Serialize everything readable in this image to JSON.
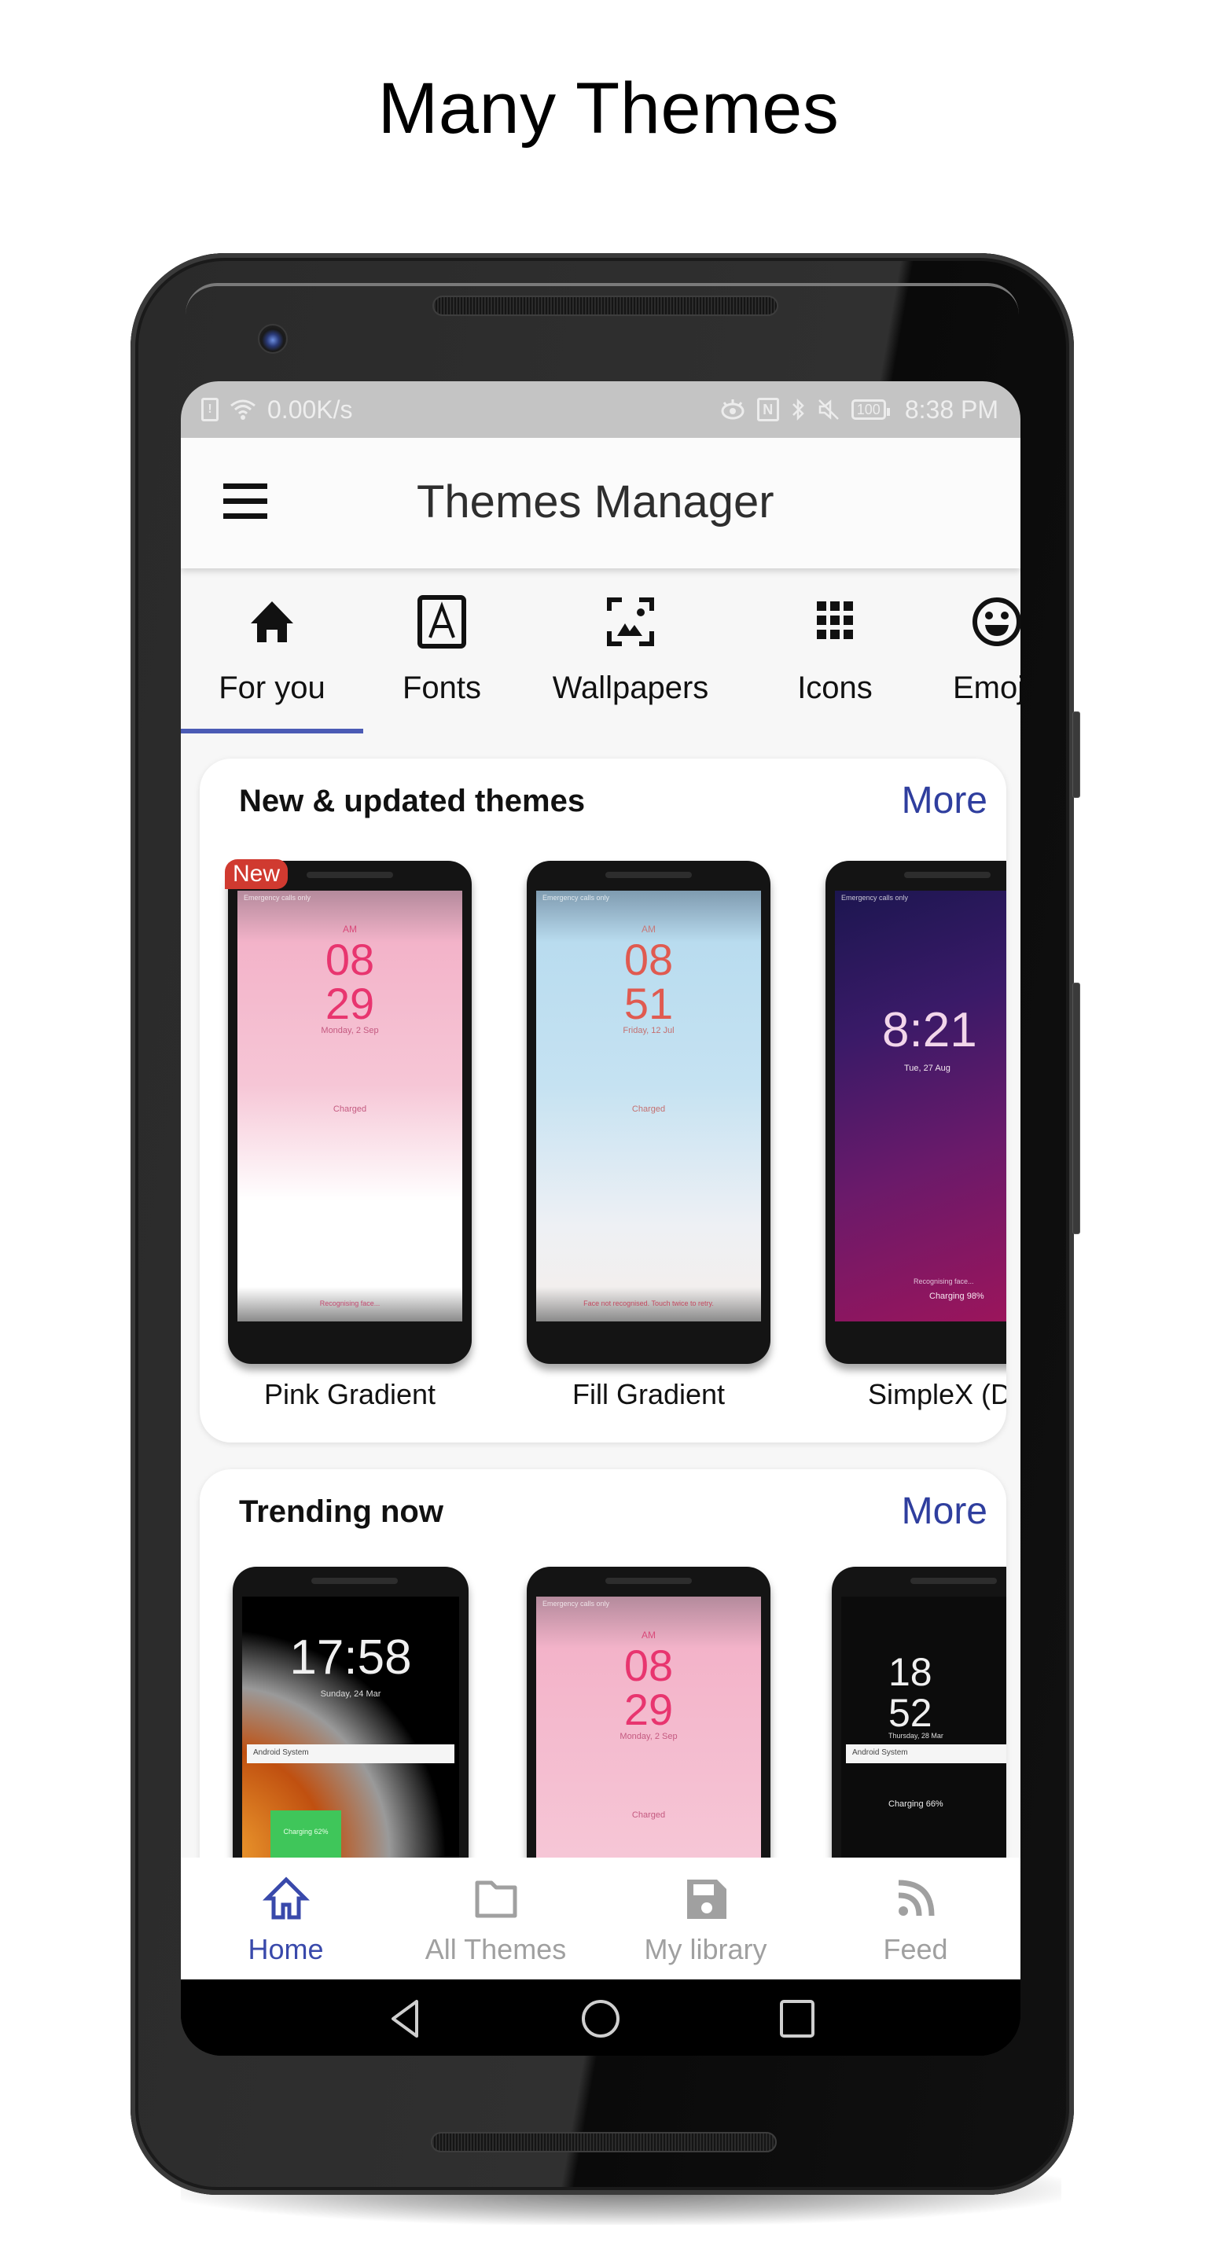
{
  "headline": "Many Themes",
  "status_bar": {
    "network_speed": "0.00K/s",
    "battery": "100",
    "time": "8:38 PM",
    "icons_left": [
      "sim-alert-icon",
      "wifi-icon"
    ],
    "icons_right": [
      "eye-comfort-icon",
      "nfc-icon",
      "bluetooth-icon",
      "mute-icon",
      "battery-icon"
    ]
  },
  "appbar": {
    "menu_icon": "hamburger-menu-icon",
    "title": "Themes Manager"
  },
  "tabs": [
    {
      "label": "For you",
      "icon": "home-icon",
      "active": true
    },
    {
      "label": "Fonts",
      "icon": "font-icon",
      "active": false
    },
    {
      "label": "Wallpapers",
      "icon": "wallpaper-icon",
      "active": false
    },
    {
      "label": "Icons",
      "icon": "grid-icon",
      "active": false
    },
    {
      "label": "Emoji",
      "icon": "emoji-icon",
      "active": false
    }
  ],
  "accent_color": "#3949ab",
  "sections": [
    {
      "title": "New & updated themes",
      "more_label": "More",
      "items": [
        {
          "name": "Pink Gradient",
          "badge": "New",
          "preview": {
            "status": "Emergency calls only",
            "ampm": "AM",
            "hour": "08",
            "minute": "29",
            "date": "Monday, 2 Sep",
            "charge": "Charged",
            "hint": "Recognising face..."
          }
        },
        {
          "name": "Fill Gradient",
          "badge": "",
          "preview": {
            "status": "Emergency calls only",
            "ampm": "AM",
            "hour": "08",
            "minute": "51",
            "date": "Friday, 12 Jul",
            "charge": "Charged",
            "hint": "Face not recognised. Touch twice to retry."
          }
        },
        {
          "name": "SimpleX (Da",
          "badge": "",
          "preview": {
            "status": "Emergency calls only",
            "time": "8:21",
            "date": "Tue, 27 Aug",
            "hint": "Recognising face...",
            "charge": "Charging 98%"
          }
        }
      ]
    },
    {
      "title": "Trending now",
      "more_label": "More",
      "items": [
        {
          "name": "",
          "preview": {
            "time": "17:58",
            "date": "Sunday, 24 Mar",
            "notification": "Android System",
            "charge": "Charging 62%"
          }
        },
        {
          "name": "",
          "preview": {
            "status": "Emergency calls only",
            "ampm": "AM",
            "hour": "08",
            "minute": "29",
            "date": "Monday, 2 Sep",
            "charge": "Charged"
          }
        },
        {
          "name": "",
          "preview": {
            "hour": "18",
            "minute": "52",
            "date": "Thursday, 28 Mar",
            "notification": "Android System",
            "charge": "Charging 66%"
          }
        }
      ]
    }
  ],
  "bottom_nav": [
    {
      "label": "Home",
      "icon": "home-outline-icon",
      "active": true
    },
    {
      "label": "All Themes",
      "icon": "folder-icon",
      "active": false
    },
    {
      "label": "My library",
      "icon": "save-icon",
      "active": false
    },
    {
      "label": "Feed",
      "icon": "rss-feed-icon",
      "active": false
    }
  ],
  "system_nav": [
    "back-icon",
    "home-circle-icon",
    "recents-icon"
  ]
}
